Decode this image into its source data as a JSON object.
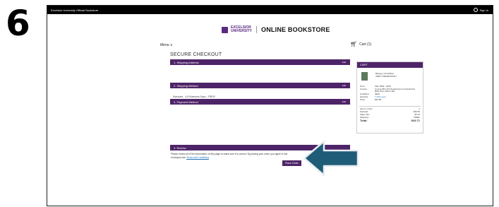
{
  "step": {
    "number": "6"
  },
  "topbar": {
    "site_name": "Excelsior University Official Bookstore",
    "sign_in": "Sign In"
  },
  "header": {
    "logo_line1": "EXCELSIOR",
    "logo_line2": "UNIVERSITY",
    "store_name": "ONLINE BOOKSTORE",
    "menu": "Menu ∨",
    "cart": "Cart (1)"
  },
  "checkout": {
    "title": "SECURE CHECKOUT",
    "sections": [
      {
        "label": "1. Shipping Address",
        "edit": "Edit"
      },
      {
        "label": "2. Shipping Method",
        "edit": "Edit"
      },
      {
        "label": "3. Payment Method",
        "edit": "Edit"
      },
      {
        "label": "4. Review"
      }
    ],
    "shipping_method_value": "Standard - 4-8 Business Days - FREE!",
    "review": {
      "text": "Please review all of the information on this page to make sure it is correct. By placing your order, you agree to the eCampus.com",
      "link": "Terms and Conditions",
      "suffix": ".",
      "button": "Place Order"
    }
  },
  "cart_panel": {
    "title": "CART",
    "book_title": "Biology, 2nd Edition",
    "isbn": "ISBN: 9780387315317",
    "details": [
      {
        "k": "Term:",
        "v": "Fall I 8Wk - 2025"
      },
      {
        "k": "Course:",
        "v": "Course BIO 110 Department of Liberal Arts"
      },
      {
        "k": "",
        "v": "BIOLOGY (Web Lab)"
      },
      {
        "k": "Condition:",
        "v": "NEW"
      },
      {
        "k": "Quantity:",
        "v": "1 (Remove)"
      },
      {
        "k": "Price:",
        "v": "$40.55"
      }
    ],
    "totals": [
      {
        "k": "Items in Cart:",
        "v": "1"
      },
      {
        "k": "Subtotal:",
        "v": "$40.55"
      },
      {
        "k": "Sales Tax:",
        "v": "$3.16"
      },
      {
        "k": "Shipping:",
        "v": "FREE!"
      }
    ],
    "total": {
      "k": "Total:",
      "v": "$43.71"
    }
  },
  "colors": {
    "brand_purple": "#4e2468",
    "arrow_teal": "#1f5c78",
    "link_blue": "#1b6fb5"
  }
}
